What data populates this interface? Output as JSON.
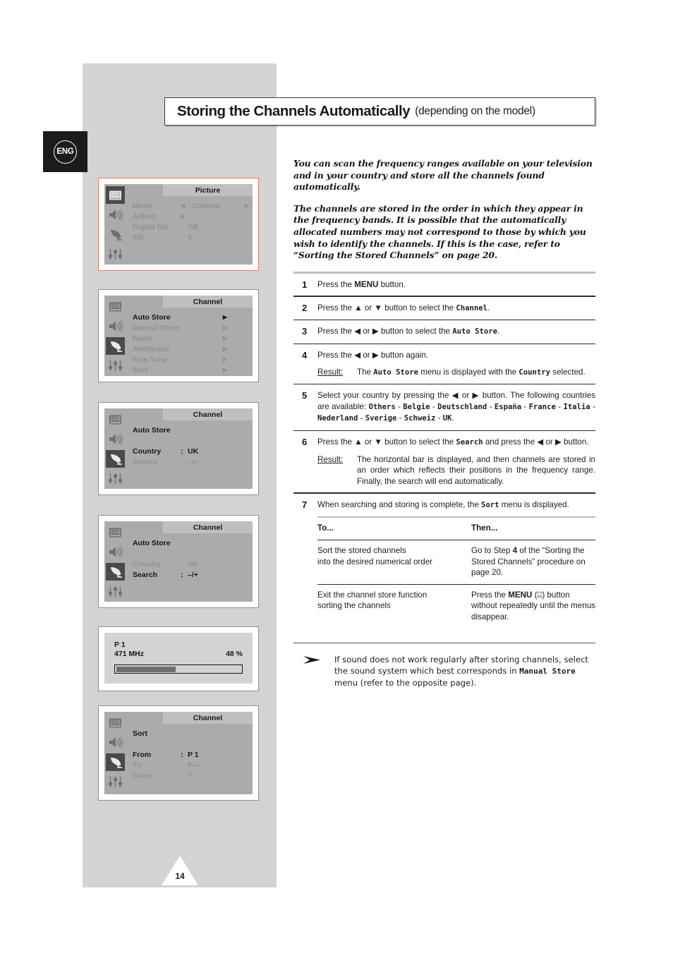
{
  "page": {
    "number": "14",
    "language_badge": "ENG"
  },
  "header": {
    "title": "Storing the Channels Automatically",
    "subtitle": "(depending on the model)"
  },
  "intro": {
    "paragraph1": "You can scan the frequency ranges available on your television and in your country and store all the channels found automatically.",
    "paragraph2": "The channels are stored in the order in which they appear in the frequency bands. It is possible that the automatically allocated numbers may not correspond to those by which you wish to identify the channels. If this is the case, refer to “Sorting the Stored Channels” on page 20."
  },
  "steps": [
    {
      "num": "1",
      "text_parts": [
        "Press the ",
        "MENU",
        " button."
      ],
      "text": "Press the MENU button."
    },
    {
      "num": "2",
      "text": "Press the ▲ or ▼ button to select the Channel.",
      "mono_term": "Channel"
    },
    {
      "num": "3",
      "text": "Press the ◀ or ▶ button to select the Auto Store.",
      "mono_term": "Auto Store"
    },
    {
      "num": "4",
      "text": "Press the ◀ or ▶ button again.",
      "result_label": "Result:",
      "result_text": "The Auto Store menu is displayed with the Country selected."
    },
    {
      "num": "5",
      "text": "Select your country by pressing the ◀ or ▶ button. The following countries are available: Others - Belgie - Deutschland - España - France - Italia - Nederland - Sverige - Schweiz - UK.",
      "countries": [
        "Others",
        "Belgie",
        "Deutschland",
        "España",
        "France",
        "Italia",
        "Nederland",
        "Sverige",
        "Schweiz",
        "UK"
      ]
    },
    {
      "num": "6",
      "text": "Press the ▲ or ▼ button to select the Search and press the ◀ or ▶ button.",
      "result_label": "Result:",
      "result_text": "The horizontal bar is displayed, and then channels are stored in an order which reflects their positions in the frequency range. Finally, the search will end automatically."
    },
    {
      "num": "7",
      "text": "When searching and storing is complete, the Sort menu is displayed.",
      "mono_term": "Sort"
    }
  ],
  "step7_table": {
    "headers": [
      "To...",
      "Then..."
    ],
    "rows": [
      {
        "to": "Sort the stored channels into the desired numerical order",
        "then": "Go to Step 4 of the “Sorting the Stored Channels” procedure on page 20."
      },
      {
        "to": "Exit the channel store function sorting the channels",
        "then": "Press the MENU (⌸) button without repeatedly until the menus disappear."
      }
    ]
  },
  "note": {
    "text": "If sound does not work regularly after storing channels, select the sound system which best corresponds in Manual Store menu (refer to the opposite page).",
    "mono_term": "Manual Store"
  },
  "osd_screens": [
    {
      "id": "picture-menu",
      "title": "Picture",
      "highlight": true,
      "selected_icon": 0,
      "rows": [
        {
          "label": "Mode",
          "value": "Custom",
          "dim": true,
          "arrows": "both"
        },
        {
          "label": "Adjust",
          "value": "",
          "dim": true,
          "arrows": "right-inline"
        },
        {
          "label": "Digital NR",
          "colon": ":",
          "value": "Off",
          "dim": true
        },
        {
          "label": "Tilt",
          "colon": ":",
          "value": "0",
          "dim": true
        }
      ]
    },
    {
      "id": "channel-menu",
      "title": "Channel",
      "highlight": false,
      "selected_icon": 2,
      "rows": [
        {
          "label": "Auto Store",
          "dim": false,
          "arrows": "far-right"
        },
        {
          "label": "Manual Store",
          "dim": true,
          "arrows": "far-right"
        },
        {
          "label": "Name",
          "dim": true,
          "arrows": "far-right"
        },
        {
          "label": "Add/Erase",
          "dim": true,
          "arrows": "far-right"
        },
        {
          "label": "Fine Tune",
          "dim": true,
          "arrows": "far-right"
        },
        {
          "label": "Sort",
          "dim": true,
          "arrows": "far-right"
        }
      ]
    },
    {
      "id": "auto-store-country",
      "title": "Channel",
      "highlight": false,
      "selected_icon": 2,
      "rows": [
        {
          "label": "Auto Store",
          "dim": false
        },
        {
          "spacer": true
        },
        {
          "label": "Country",
          "colon": ":",
          "value": "UK",
          "dim": false
        },
        {
          "label": "Search",
          "colon": ":",
          "value": "–/+",
          "dim": true
        }
      ]
    },
    {
      "id": "auto-store-search",
      "title": "Channel",
      "highlight": false,
      "selected_icon": 2,
      "rows": [
        {
          "label": "Auto Store",
          "dim": false
        },
        {
          "spacer": true
        },
        {
          "label": "Country",
          "colon": ":",
          "value": "UK",
          "dim": true
        },
        {
          "label": "Search",
          "colon": ":",
          "value": "–/+",
          "dim": false
        }
      ]
    },
    {
      "id": "sort-menu",
      "title": "Channel",
      "highlight": false,
      "selected_icon": 2,
      "rows": [
        {
          "label": "Sort",
          "dim": false
        },
        {
          "spacer": true
        },
        {
          "label": "From",
          "colon": ":",
          "value": "P 1",
          "dim": false
        },
        {
          "label": "To",
          "colon": ":",
          "value": "P––",
          "dim": true
        },
        {
          "label": "Store",
          "colon": ":",
          "value": "?",
          "dim": true
        }
      ]
    }
  ],
  "progress_screen": {
    "id": "search-progress",
    "channel": "P 1",
    "frequency": "471 MHz",
    "percent_label": "48 %",
    "percent_value": 48
  },
  "icons": [
    "picture-icon",
    "sound-icon",
    "channel-icon",
    "setup-icon"
  ]
}
